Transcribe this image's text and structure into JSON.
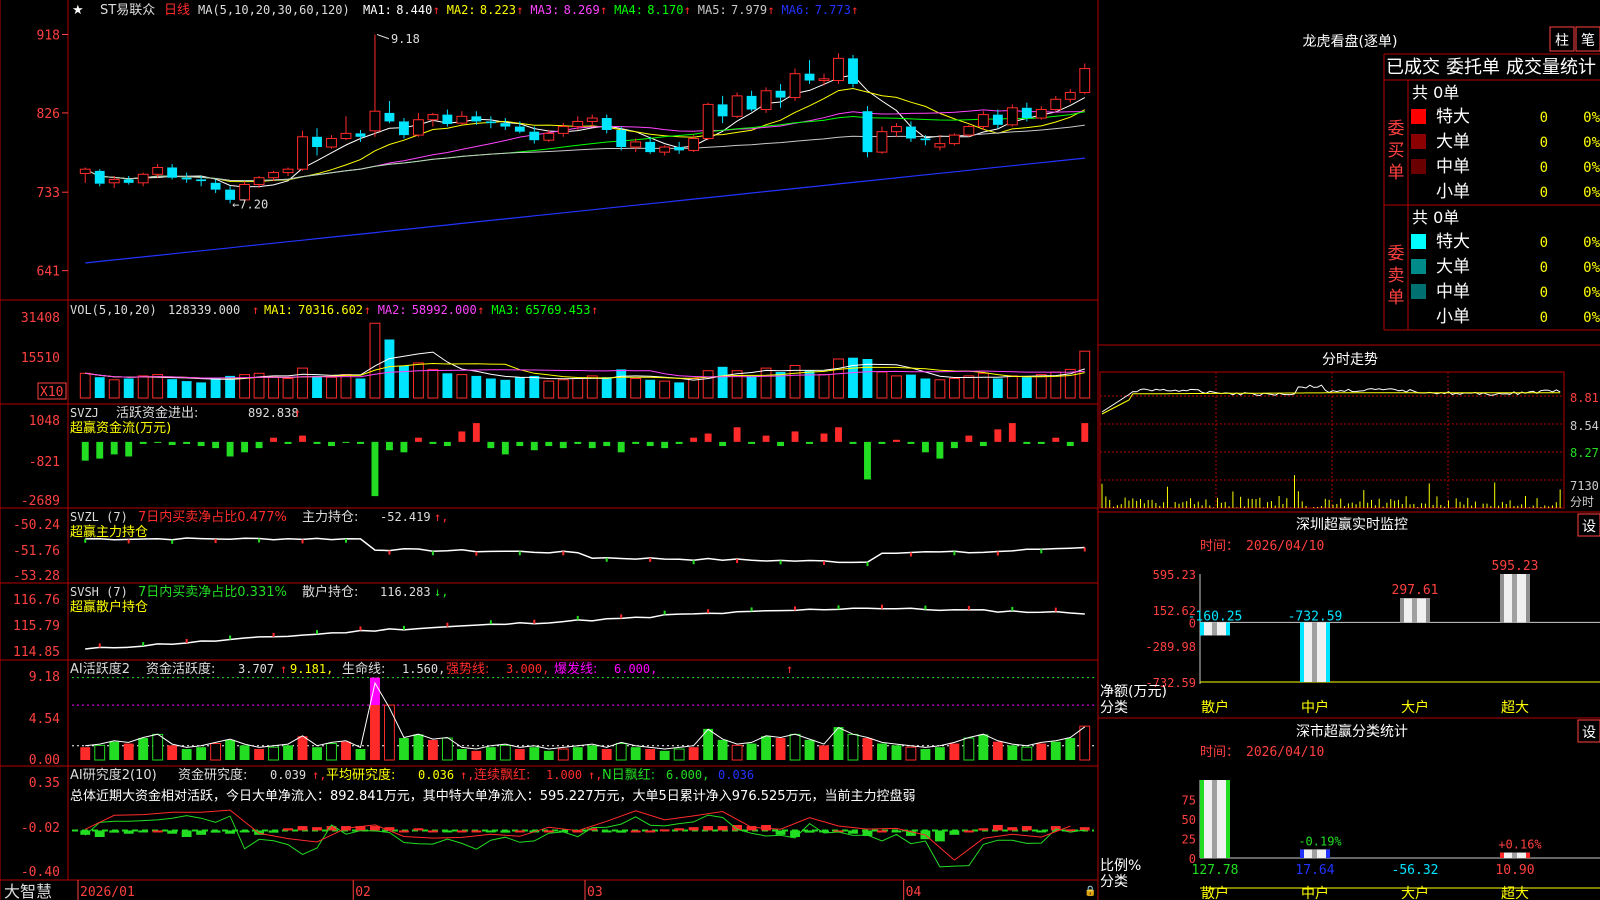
{
  "colors": {
    "frame": "#b40000",
    "up": "#ff2b2b",
    "down": "#00e5ff",
    "green": "#22dd22",
    "ma1": "#ffffff",
    "ma2": "#ffff00",
    "ma3": "#ff44ff",
    "ma4": "#00ff00",
    "ma5": "#c8c8c8",
    "ma6": "#2233ff",
    "text": "#cccccc",
    "yellow": "#ffff00",
    "magenta": "#ff00ff",
    "axisred": "#ff4040"
  },
  "price_panel": {
    "star_icon": "star-icon",
    "title": "ST易联众",
    "period": "日线",
    "ma_label": "MA(5,10,20,30,60,120)",
    "ma_values": [
      {
        "name": "MA1:",
        "value": "8.440",
        "arrow": "↑",
        "color_key": "ma1"
      },
      {
        "name": "MA2:",
        "value": "8.223",
        "arrow": "↑",
        "color_key": "ma2"
      },
      {
        "name": "MA3:",
        "value": "8.269",
        "arrow": "↑",
        "color_key": "ma3"
      },
      {
        "name": "MA4:",
        "value": "8.170",
        "arrow": "↑",
        "color_key": "ma4"
      },
      {
        "name": "MA5:",
        "value": "7.979",
        "arrow": "↑",
        "color_key": "ma5"
      },
      {
        "name": "MA6:",
        "value": "7.773",
        "arrow": "↑",
        "color_key": "ma6"
      }
    ],
    "y_ticks": [
      "918",
      "826",
      "733",
      "641"
    ],
    "high_marker": "9.18",
    "low_marker": "7.20"
  },
  "volume_panel": {
    "label": "VOL(5,10,20)",
    "value": "128339.000",
    "ma_values": [
      {
        "name": "MA1:",
        "value": "70316.602",
        "color_key": "ma2"
      },
      {
        "name": "MA2:",
        "value": "58992.000",
        "color_key": "ma3"
      },
      {
        "name": "MA3:",
        "value": "65769.453",
        "color_key": "ma4"
      }
    ],
    "y_ticks": [
      "31408",
      "15510"
    ],
    "multiplier": "X10"
  },
  "svzj_panel": {
    "label": "SVZJ",
    "desc": "活跃资金进出:",
    "value": "892.838",
    "sub_label": "超赢资金流(万元)",
    "y_ticks": [
      "1048",
      "-821",
      "-2689"
    ]
  },
  "svzl_panel": {
    "label": "SVZL (7)",
    "desc": "7日内买卖净占比0.477%",
    "desc2": "主力持仓:",
    "value": "-52.419",
    "sub_label": "超赢主力持仓",
    "y_ticks": [
      "-50.24",
      "-51.76",
      "-53.28"
    ]
  },
  "svsh_panel": {
    "label": "SVSH (7)",
    "desc": "7日内买卖净占比0.331%",
    "desc2": "散户持仓:",
    "value": "116.283",
    "sub_label": "超赢散户持仓",
    "y_ticks": [
      "116.76",
      "115.79",
      "114.85"
    ]
  },
  "ai_active_panel": {
    "label": "AI活跃度2",
    "desc": "资金活跃度:",
    "value": "3.707",
    "value2": "9.181,",
    "line_label": "生命线:",
    "line_value": "1.560,",
    "strong_label": "强势线:",
    "strong_value": "3.000,",
    "burst_label": "爆发线:",
    "burst_value": "6.000,",
    "y_ticks": [
      "9.18",
      "4.54",
      "0.00"
    ]
  },
  "ai_research_panel": {
    "label": "AI研究度2(10)",
    "desc": "资金研究度:",
    "value": "0.039",
    "avg_label": "平均研究度:",
    "avg_value": "0.036",
    "red_label": "连续飘红:",
    "red_value": "1.000",
    "nred_label": "N日飘红:",
    "nred_value": "6.000,",
    "last_value": "0.036",
    "summary": "总体近期大资金相对活跃，今日大单净流入：892.841万元，其中特大单净流入：595.227万元，大单5日累计净入976.525万元，当前主力控盘弱",
    "y_ticks": [
      "0.35",
      "-0.02",
      "-0.40"
    ]
  },
  "x_axis": {
    "labels": [
      "2026/01",
      "02",
      "03",
      "04"
    ],
    "brand": "大智慧"
  },
  "lhkp": {
    "title": "龙虎看盘(逐单)",
    "btn1": "柱",
    "btn2": "笔",
    "tabs": [
      "已成交",
      "委托单",
      "成交量统计"
    ],
    "buy_side": "委买单",
    "sell_side": "委卖单",
    "buy_total": "共 0单",
    "sell_total": "共 0单",
    "rows_buy": [
      {
        "label": "特大",
        "count": "0",
        "pct": "0%",
        "color": "#ff0000"
      },
      {
        "label": "大单",
        "count": "0",
        "pct": "0%",
        "color": "#8b0000"
      },
      {
        "label": "中单",
        "count": "0",
        "pct": "0%",
        "color": "#6b0000"
      },
      {
        "label": "小单",
        "count": "0",
        "pct": "0%",
        "color": "#000000"
      }
    ],
    "rows_sell": [
      {
        "label": "特大",
        "count": "0",
        "pct": "0%",
        "color": "#00ffff"
      },
      {
        "label": "大单",
        "count": "0",
        "pct": "0%",
        "color": "#008b8b"
      },
      {
        "label": "中单",
        "count": "0",
        "pct": "0%",
        "color": "#007070"
      },
      {
        "label": "小单",
        "count": "0",
        "pct": "0%",
        "color": "#000000"
      }
    ]
  },
  "intraday": {
    "title": "分时走势",
    "y_ticks": [
      "8.81",
      "8.54",
      "8.27"
    ],
    "vol_label": "7130",
    "unit": "分时"
  },
  "sz_monitor": {
    "title": "深圳超赢实时监控",
    "settings": "设",
    "time_label": "时间：",
    "time_value": "2026/04/10",
    "y_ticks": [
      "595.23",
      "152.62",
      "0",
      "-289.98",
      "-732.59"
    ],
    "y_title": "净额(万元)",
    "x_title": "分类",
    "categories": [
      "散户",
      "中户",
      "大户",
      "超大"
    ],
    "values": [
      -160.25,
      -732.59,
      297.61,
      595.23
    ],
    "value_labels": [
      "-160.25",
      "-732.59",
      "297.61",
      "595.23"
    ]
  },
  "sz_category": {
    "title": "深市超赢分类统计",
    "settings": "设",
    "time_label": "时间：",
    "time_value": "2026/04/10",
    "y_ticks": [
      "75",
      "50",
      "25",
      "0"
    ],
    "y_title": "比例%",
    "x_title": "分类",
    "categories": [
      "散户",
      "中户",
      "大户",
      "超大"
    ],
    "values": [
      127.78,
      17.64,
      -56.32,
      10.9
    ],
    "value_labels": [
      "127.78",
      "17.64",
      "-56.32",
      "10.90"
    ],
    "pct_labels": [
      "",
      "-0.19%",
      "",
      "+0.16%"
    ]
  },
  "chart_data": {
    "type": "candlestick",
    "ohlc": [
      [
        7.55,
        7.62,
        7.44,
        7.6
      ],
      [
        7.58,
        7.6,
        7.4,
        7.43
      ],
      [
        7.44,
        7.52,
        7.38,
        7.48
      ],
      [
        7.48,
        7.52,
        7.42,
        7.44
      ],
      [
        7.44,
        7.56,
        7.4,
        7.54
      ],
      [
        7.54,
        7.66,
        7.5,
        7.62
      ],
      [
        7.62,
        7.66,
        7.48,
        7.5
      ],
      [
        7.5,
        7.56,
        7.44,
        7.48
      ],
      [
        7.48,
        7.52,
        7.4,
        7.46
      ],
      [
        7.44,
        7.48,
        7.32,
        7.36
      ],
      [
        7.36,
        7.4,
        7.2,
        7.24
      ],
      [
        7.24,
        7.46,
        7.22,
        7.42
      ],
      [
        7.42,
        7.52,
        7.38,
        7.5
      ],
      [
        7.5,
        7.58,
        7.46,
        7.56
      ],
      [
        7.56,
        7.62,
        7.52,
        7.6
      ],
      [
        7.6,
        8.05,
        7.58,
        7.98
      ],
      [
        7.98,
        8.08,
        7.76,
        7.86
      ],
      [
        7.86,
        8.0,
        7.84,
        7.96
      ],
      [
        7.96,
        8.22,
        7.94,
        8.02
      ],
      [
        8.02,
        8.06,
        7.92,
        7.98
      ],
      [
        8.05,
        9.18,
        7.98,
        8.28
      ],
      [
        8.26,
        8.4,
        8.14,
        8.16
      ],
      [
        8.16,
        8.2,
        7.96,
        8.0
      ],
      [
        8.0,
        8.26,
        7.98,
        8.18
      ],
      [
        8.18,
        8.26,
        8.1,
        8.24
      ],
      [
        8.24,
        8.3,
        8.1,
        8.13
      ],
      [
        8.14,
        8.28,
        8.12,
        8.22
      ],
      [
        8.22,
        8.28,
        8.12,
        8.16
      ],
      [
        8.16,
        8.22,
        8.08,
        8.14
      ],
      [
        8.14,
        8.2,
        8.06,
        8.1
      ],
      [
        8.1,
        8.16,
        8.02,
        8.04
      ],
      [
        8.04,
        8.1,
        7.9,
        7.94
      ],
      [
        7.94,
        8.06,
        7.92,
        8.02
      ],
      [
        8.02,
        8.14,
        7.98,
        8.1
      ],
      [
        8.1,
        8.22,
        8.06,
        8.16
      ],
      [
        8.16,
        8.24,
        8.1,
        8.2
      ],
      [
        8.2,
        8.24,
        8.02,
        8.06
      ],
      [
        8.06,
        8.1,
        7.82,
        7.86
      ],
      [
        7.86,
        7.96,
        7.8,
        7.92
      ],
      [
        7.92,
        7.98,
        7.78,
        7.8
      ],
      [
        7.8,
        7.88,
        7.76,
        7.86
      ],
      [
        7.86,
        7.92,
        7.78,
        7.82
      ],
      [
        7.82,
        8.0,
        7.8,
        7.96
      ],
      [
        7.96,
        8.38,
        7.94,
        8.36
      ],
      [
        8.36,
        8.46,
        8.14,
        8.22
      ],
      [
        8.22,
        8.5,
        8.2,
        8.46
      ],
      [
        8.46,
        8.52,
        8.28,
        8.3
      ],
      [
        8.3,
        8.56,
        8.26,
        8.52
      ],
      [
        8.52,
        8.6,
        8.32,
        8.44
      ],
      [
        8.44,
        8.78,
        8.4,
        8.72
      ],
      [
        8.72,
        8.88,
        8.6,
        8.64
      ],
      [
        8.64,
        8.72,
        8.58,
        8.66
      ],
      [
        8.64,
        8.96,
        8.6,
        8.9
      ],
      [
        8.9,
        8.94,
        8.56,
        8.6
      ],
      [
        8.28,
        8.34,
        7.74,
        7.8
      ],
      [
        7.8,
        8.1,
        7.78,
        8.04
      ],
      [
        8.04,
        8.14,
        7.98,
        8.1
      ],
      [
        8.1,
        8.16,
        7.92,
        7.96
      ],
      [
        7.96,
        8.0,
        7.88,
        7.94
      ],
      [
        7.86,
        8.0,
        7.82,
        7.9
      ],
      [
        7.9,
        8.02,
        7.88,
        8.0
      ],
      [
        8.0,
        8.12,
        7.98,
        8.1
      ],
      [
        8.1,
        8.28,
        8.06,
        8.24
      ],
      [
        8.24,
        8.3,
        8.08,
        8.12
      ],
      [
        8.12,
        8.36,
        8.1,
        8.32
      ],
      [
        8.32,
        8.38,
        8.16,
        8.2
      ],
      [
        8.2,
        8.34,
        8.18,
        8.3
      ],
      [
        8.3,
        8.46,
        8.28,
        8.42
      ],
      [
        8.42,
        8.54,
        8.38,
        8.5
      ],
      [
        8.5,
        8.84,
        8.48,
        8.78
      ]
    ]
  }
}
